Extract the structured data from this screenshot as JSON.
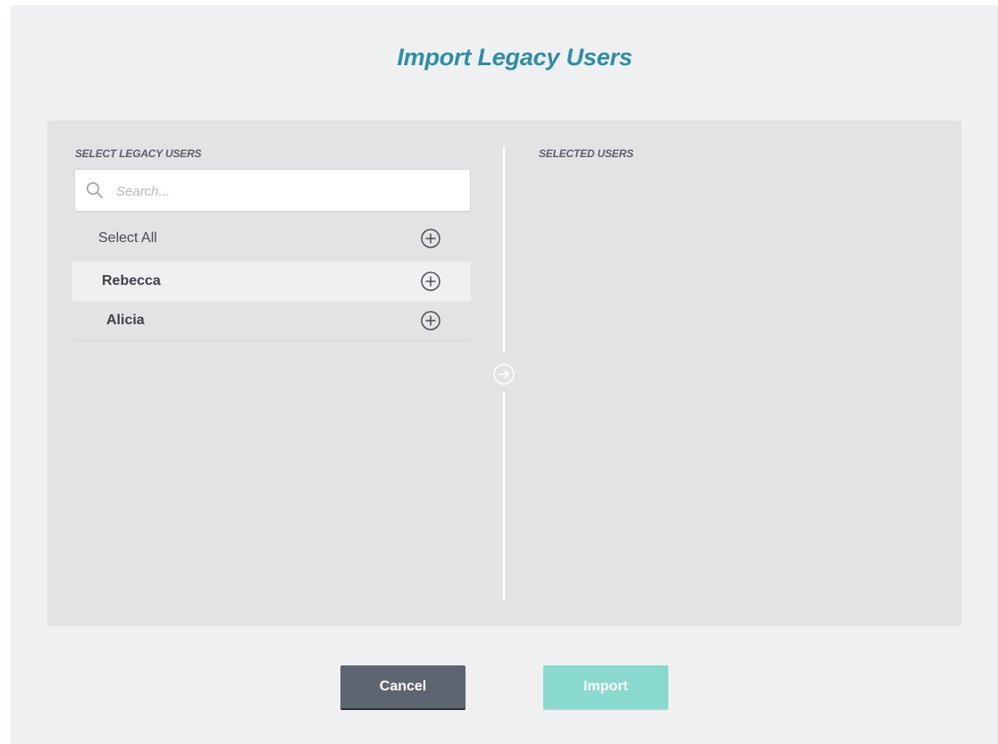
{
  "dialog": {
    "title": "Import Legacy Users"
  },
  "left_panel": {
    "label": "SELECT LEGACY USERS",
    "search": {
      "placeholder": "Search...",
      "value": ""
    },
    "select_all_label": "Select All",
    "users": [
      {
        "name": "Rebecca"
      },
      {
        "name": "Alicia"
      }
    ]
  },
  "right_panel": {
    "label": "SELECTED USERS"
  },
  "buttons": {
    "cancel_label": "Cancel",
    "import_label": "Import"
  },
  "colors": {
    "title": "#2e8ea3",
    "panel_bg": "#e2e3e5",
    "cancel_bg": "#5d6670",
    "import_bg": "#8ad9cf"
  }
}
